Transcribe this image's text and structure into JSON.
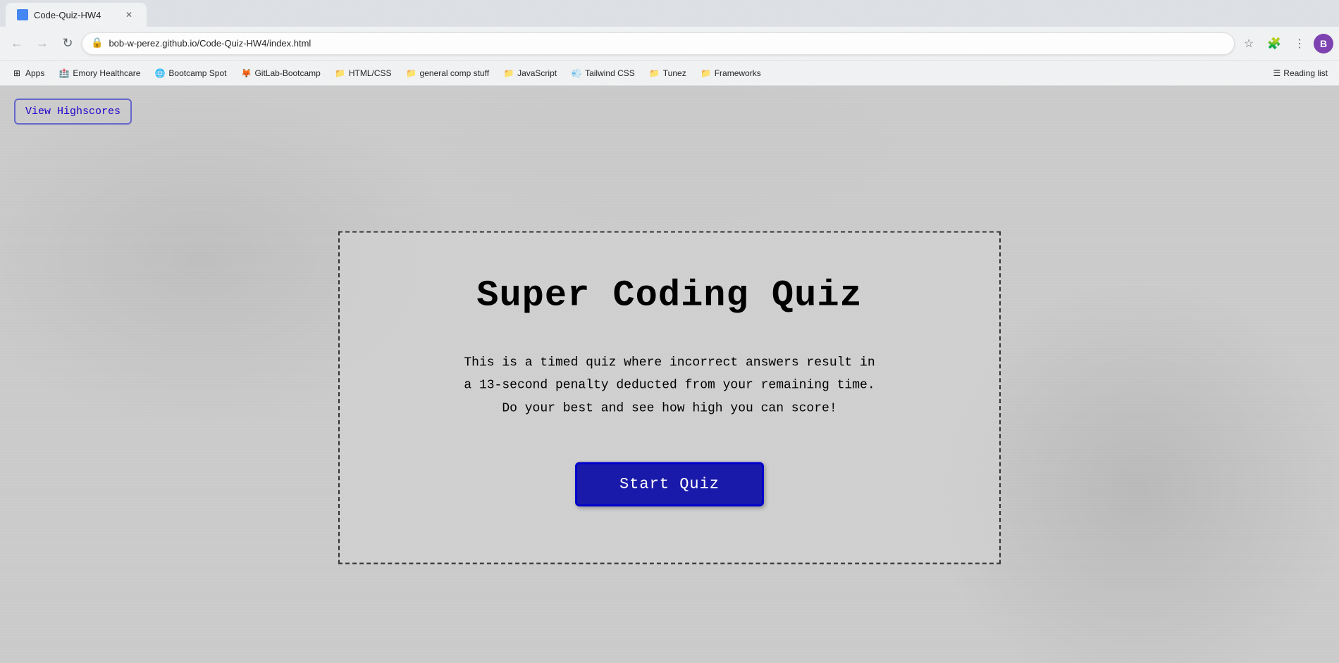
{
  "browser": {
    "tab_title": "Code-Quiz-HW4",
    "url": "bob-w-perez.github.io/Code-Quiz-HW4/index.html",
    "profile_initial": "B",
    "back_btn": "←",
    "forward_btn": "→",
    "reload_btn": "↻"
  },
  "bookmarks": [
    {
      "label": "Apps",
      "icon": "⊞",
      "type": "apps"
    },
    {
      "label": "Emory Healthcare",
      "icon": "🏥",
      "type": "site"
    },
    {
      "label": "Bootcamp Spot",
      "icon": "🌐",
      "type": "site"
    },
    {
      "label": "GitLab-Bootcamp",
      "icon": "🦊",
      "type": "site"
    },
    {
      "label": "HTML/CSS",
      "icon": "📁",
      "type": "folder"
    },
    {
      "label": "general comp stuff",
      "icon": "📁",
      "type": "folder"
    },
    {
      "label": "JavaScript",
      "icon": "📁",
      "type": "folder"
    },
    {
      "label": "Tailwind CSS",
      "icon": "💨",
      "type": "site"
    },
    {
      "label": "Tunez",
      "icon": "📁",
      "type": "folder"
    },
    {
      "label": "Frameworks",
      "icon": "📁",
      "type": "folder"
    }
  ],
  "reading_list": {
    "label": "Reading list",
    "icon": "☰"
  },
  "page": {
    "view_highscores_label": "View Highscores",
    "title": "Super Coding Quiz",
    "description_line1": "This is a timed quiz where incorrect answers result in",
    "description_line2": "a 13-second penalty deducted from your remaining time.",
    "description_line3": "Do your best and see how high you can score!",
    "start_button_label": "Start Quiz"
  }
}
